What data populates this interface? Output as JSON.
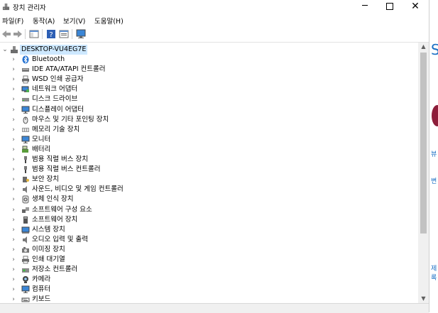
{
  "window": {
    "title": "장치 관리자"
  },
  "menu": {
    "file": "파일(F)",
    "action": "동작(A)",
    "view": "보기(V)",
    "help": "도움말(H)"
  },
  "tree": {
    "root": "DESKTOP-VU4EG7E",
    "items": [
      {
        "label": "Bluetooth",
        "icon": "bluetooth-icon"
      },
      {
        "label": "IDE ATA/ATAPI 컨트롤러",
        "icon": "ide-controller-icon"
      },
      {
        "label": "WSD 인쇄 공급자",
        "icon": "printer-icon"
      },
      {
        "label": "네트워크 어댑터",
        "icon": "network-adapter-icon"
      },
      {
        "label": "디스크 드라이브",
        "icon": "disk-drive-icon"
      },
      {
        "label": "디스플레이 어댑터",
        "icon": "display-adapter-icon"
      },
      {
        "label": "마우스 및 기타 포인팅 장치",
        "icon": "mouse-icon"
      },
      {
        "label": "메모리 기술 장치",
        "icon": "memory-device-icon"
      },
      {
        "label": "모니터",
        "icon": "monitor-icon"
      },
      {
        "label": "배터리",
        "icon": "battery-icon"
      },
      {
        "label": "범용 직렬 버스 장치",
        "icon": "usb-device-icon"
      },
      {
        "label": "범용 직렬 버스 컨트롤러",
        "icon": "usb-controller-icon"
      },
      {
        "label": "보안 장치",
        "icon": "security-device-icon"
      },
      {
        "label": "사운드, 비디오 및 게임 컨트롤러",
        "icon": "sound-controller-icon"
      },
      {
        "label": "생체 인식 장치",
        "icon": "biometric-icon"
      },
      {
        "label": "소프트웨어 구성 요소",
        "icon": "software-component-icon"
      },
      {
        "label": "소프트웨어 장치",
        "icon": "software-device-icon"
      },
      {
        "label": "시스템 장치",
        "icon": "system-device-icon"
      },
      {
        "label": "오디오 입력 및 출력",
        "icon": "audio-io-icon"
      },
      {
        "label": "이미징 장치",
        "icon": "imaging-device-icon"
      },
      {
        "label": "인쇄 대기열",
        "icon": "print-queue-icon"
      },
      {
        "label": "저장소 컨트롤러",
        "icon": "storage-controller-icon"
      },
      {
        "label": "카메라",
        "icon": "camera-icon"
      },
      {
        "label": "컴퓨터",
        "icon": "computer-icon"
      },
      {
        "label": "키보드",
        "icon": "keyboard-icon"
      }
    ]
  },
  "background_window": {
    "peek_s": "S",
    "peek_1": "뷰",
    "peek_2": "변",
    "peek_3": "제록"
  }
}
